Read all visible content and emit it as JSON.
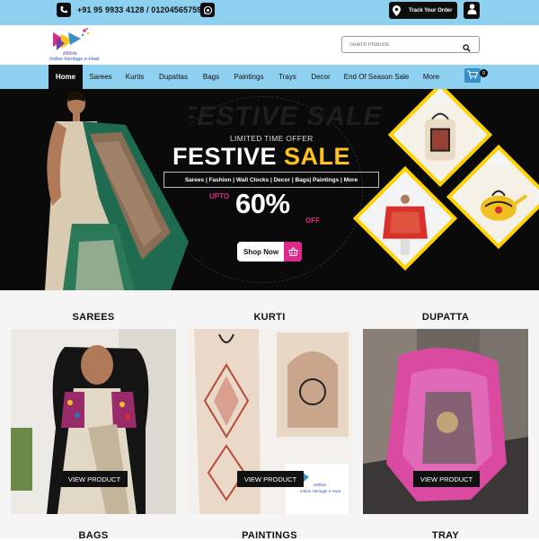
{
  "topbar": {
    "phone_text": "+91 95 9933 4128 / 01204565759",
    "track_label": "Track Your Order",
    "icons": [
      "phone-icon",
      "whatsapp-icon",
      "location-pin-icon",
      "user-icon"
    ]
  },
  "header": {
    "logo_line1": "iMithila",
    "logo_line2": "Indian Heritage e-Haat",
    "search_placeholder": "Search Products"
  },
  "nav": {
    "items": [
      {
        "label": "Home",
        "active": true
      },
      {
        "label": "Sarees"
      },
      {
        "label": "Kurtis"
      },
      {
        "label": "Dupattas"
      },
      {
        "label": "Bags"
      },
      {
        "label": "Paintings"
      },
      {
        "label": "Trays"
      },
      {
        "label": "Decor"
      },
      {
        "label": "End Of Season Sale"
      },
      {
        "label": "More"
      }
    ],
    "cart_count": "0"
  },
  "hero": {
    "bg_text": "FESTIVE SALE",
    "limited": "LIMITED TIME OFFER",
    "title_word1": "FESTIVE",
    "title_word2": "SALE",
    "categories": "Sarees | Fashion | Wall Clocks | Decor | Bags| Paintings | More",
    "upto": "UPTO",
    "percent": "60%",
    "off": "OFF",
    "cta": "Shop Now"
  },
  "products": {
    "titles": [
      "SAREES",
      "KURTI",
      "DUPATTA"
    ],
    "titles_row2": [
      "BAGS",
      "PAINTINGS",
      "TRAY"
    ],
    "view_label": "VIEW PRODUCT",
    "watermark_line1": "iMithila",
    "watermark_line2": "Indian Heritage e-Haat"
  },
  "colors": {
    "accent_blue": "#8ed0f0",
    "dark": "#0d0d0d",
    "sale_yellow": "#ffc21a",
    "pink": "#e0288a"
  }
}
